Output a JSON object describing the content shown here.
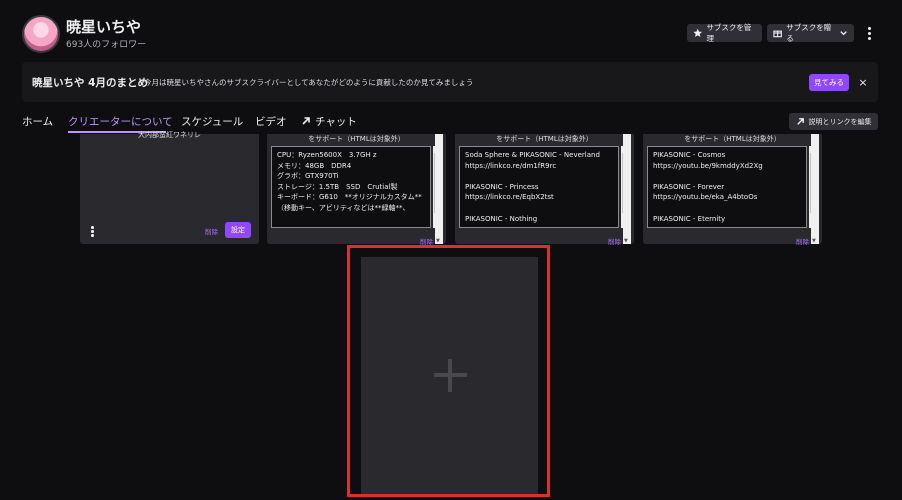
{
  "channel": {
    "name": "暁星いちや",
    "followers": "693人のフォロワー"
  },
  "header": {
    "manage_sub": "サブスクを管理",
    "gift_sub": "サブスクを贈る"
  },
  "recap": {
    "title": "暁星いちや 4月のまとめ",
    "description": "今月は暁星いちやさんのサブスクライバーとしてあなたがどのように貢献したのか見てみましょう",
    "view_button": "見てみる",
    "close": "×"
  },
  "tabs": [
    "ホーム",
    "クリエーターについて",
    "スケジュール",
    "ビデオ",
    "チャット"
  ],
  "edit_links_button": "説明とリンクを編集",
  "panels": {
    "p1": {
      "title_cut": "大内部蛮紅ワネリレ",
      "delete": "削除",
      "settings": "設定"
    },
    "p2": {
      "title_cut": "をサポート（HTMLは対象外）",
      "text": "CPU：Ryzen5600X　3.7GH z\nメモリ：48GB　DDR4\nグラボ：GTX970Ti\nストレージ：1.5TB　SSD　Crutial製\nキーボード：G610　**オリジナルカスタム**\n（移動キー、アビリティなどは**緑軸**、",
      "delete": "削除"
    },
    "p3": {
      "title_cut": "をサポート（HTMLは対象外）",
      "text": "Soda Sphere & PIKASONIC - Neverland\nhttps://linkco.re/dm1fR9rc\n\nPIKASONIC - Princess\nhttps://linkco.re/EqbX2tst\n\nPIKASONIC - Nothing",
      "delete": "削除"
    },
    "p4": {
      "title_cut": "をサポート（HTMLは対象外）",
      "text": "PIKASONIC - Cosmos\nhttps://youtu.be/9kmddyXd2Xg\n\nPIKASONIC - Forever\nhttps://youtu.be/eka_A4btoOs\n\nPIKASONIC - Eternity",
      "delete": "削除"
    }
  },
  "add_panel": {
    "icon": "plus-icon"
  },
  "colors": {
    "accent": "#9147ff",
    "accent_text": "#bf94ff",
    "highlight_border": "#d9322c",
    "background": "#0e0e10",
    "panel": "#2a2a2e"
  }
}
